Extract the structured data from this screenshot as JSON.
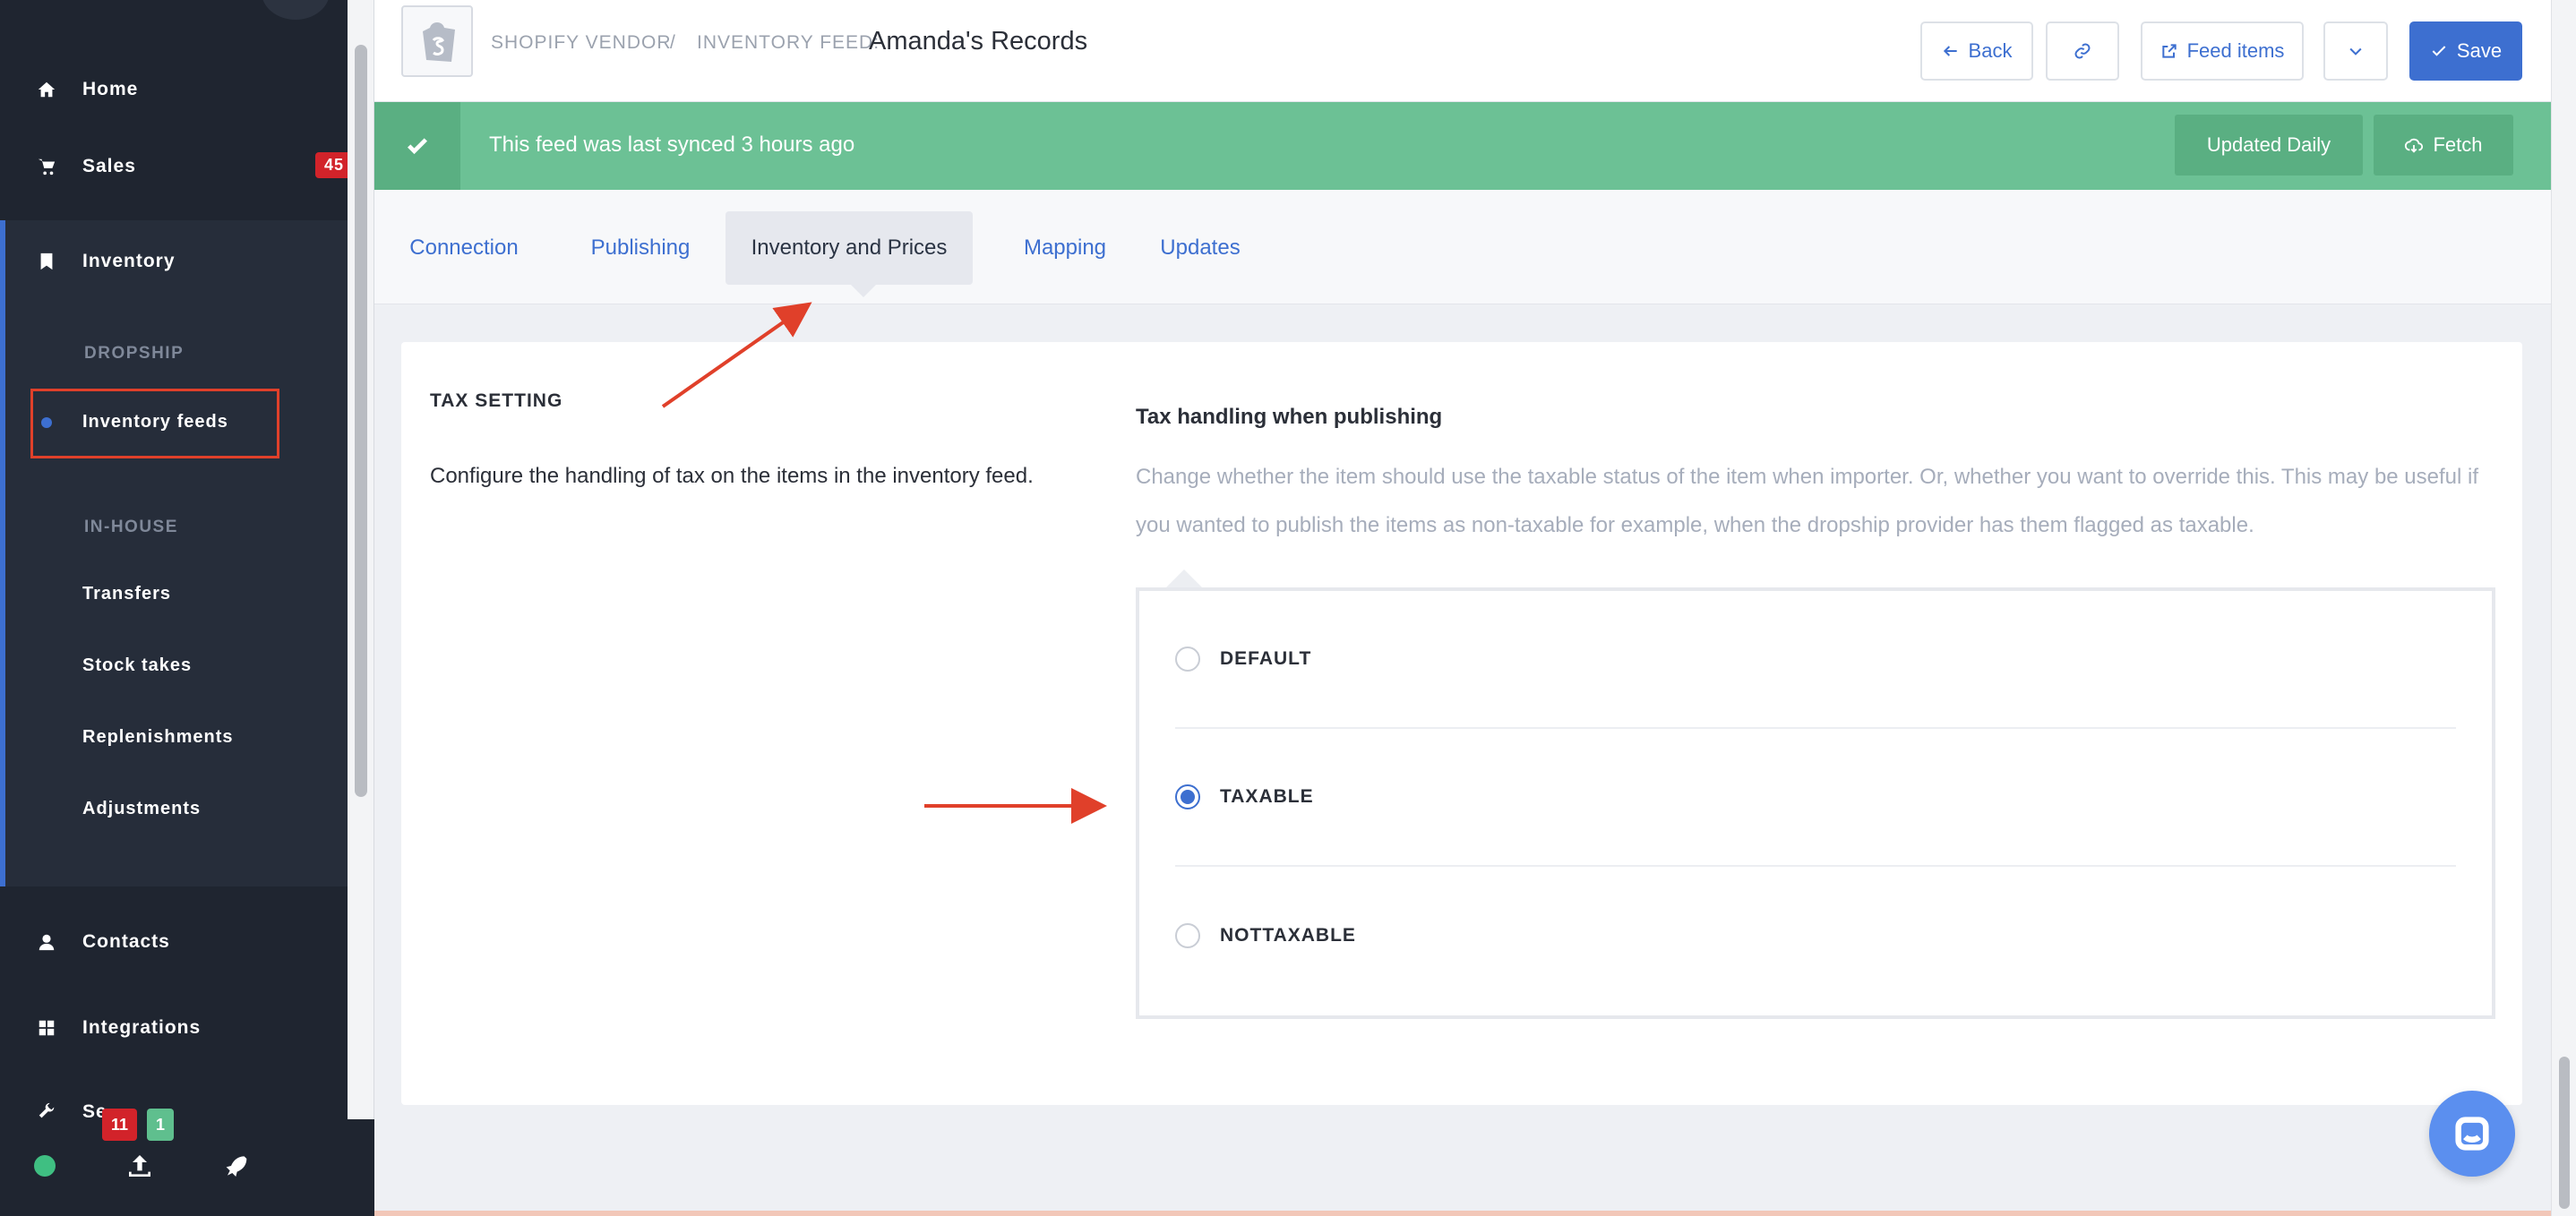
{
  "sidebar": {
    "nav": [
      {
        "label": "Home",
        "icon": "home-icon"
      },
      {
        "label": "Sales",
        "icon": "cart-icon",
        "badge": "45"
      },
      {
        "label": "Inventory",
        "icon": "bookmark-icon"
      },
      {
        "label": "Contacts",
        "icon": "user-icon"
      },
      {
        "label": "Integrations",
        "icon": "grid-icon"
      },
      {
        "label": "Se",
        "icon": "wrench-icon"
      }
    ],
    "inventory_sections": {
      "dropship_heading": "DROPSHIP",
      "dropship_items": [
        "Inventory feeds"
      ],
      "inhouse_heading": "IN-HOUSE",
      "inhouse_items": [
        "Transfers",
        "Stock takes",
        "Replenishments",
        "Adjustments"
      ]
    },
    "bottom": {
      "badge_red": "11",
      "badge_green": "1",
      "icons": [
        "status-dot",
        "upload-icon",
        "rocket-icon"
      ]
    }
  },
  "header": {
    "crumb_vendor": "SHOPIFY VENDOR",
    "crumb_separator": "/",
    "crumb_feed_prefix": "INVENTORY FEED:",
    "feed_name": "Amanda's Records",
    "buttons": {
      "back": "Back",
      "feed_items": "Feed items",
      "save": "Save"
    }
  },
  "sync": {
    "message": "This feed was last synced 3 hours ago",
    "frequency": "Updated Daily",
    "fetch": "Fetch"
  },
  "tabs": [
    "Connection",
    "Publishing",
    "Inventory and Prices",
    "Mapping",
    "Updates"
  ],
  "active_tab": "Inventory and Prices",
  "tax_setting": {
    "title": "TAX SETTING",
    "description": "Configure the handling of tax on the items in the inventory feed.",
    "handling_title": "Tax handling when publishing",
    "handling_desc": "Change whether the item should use the taxable status of the item when importer. Or, whether you want to override this. This may be useful if you wanted to publish the items as non-taxable for example, when the dropship provider has them flagged as taxable.",
    "options": [
      "DEFAULT",
      "TAXABLE",
      "NOTTAXABLE"
    ],
    "selected": "TAXABLE"
  },
  "colors": {
    "accent": "#3d6fd0",
    "sidebar": "#1f2530",
    "sync_green": "#6cc195",
    "annotation_red": "#e0402a"
  }
}
